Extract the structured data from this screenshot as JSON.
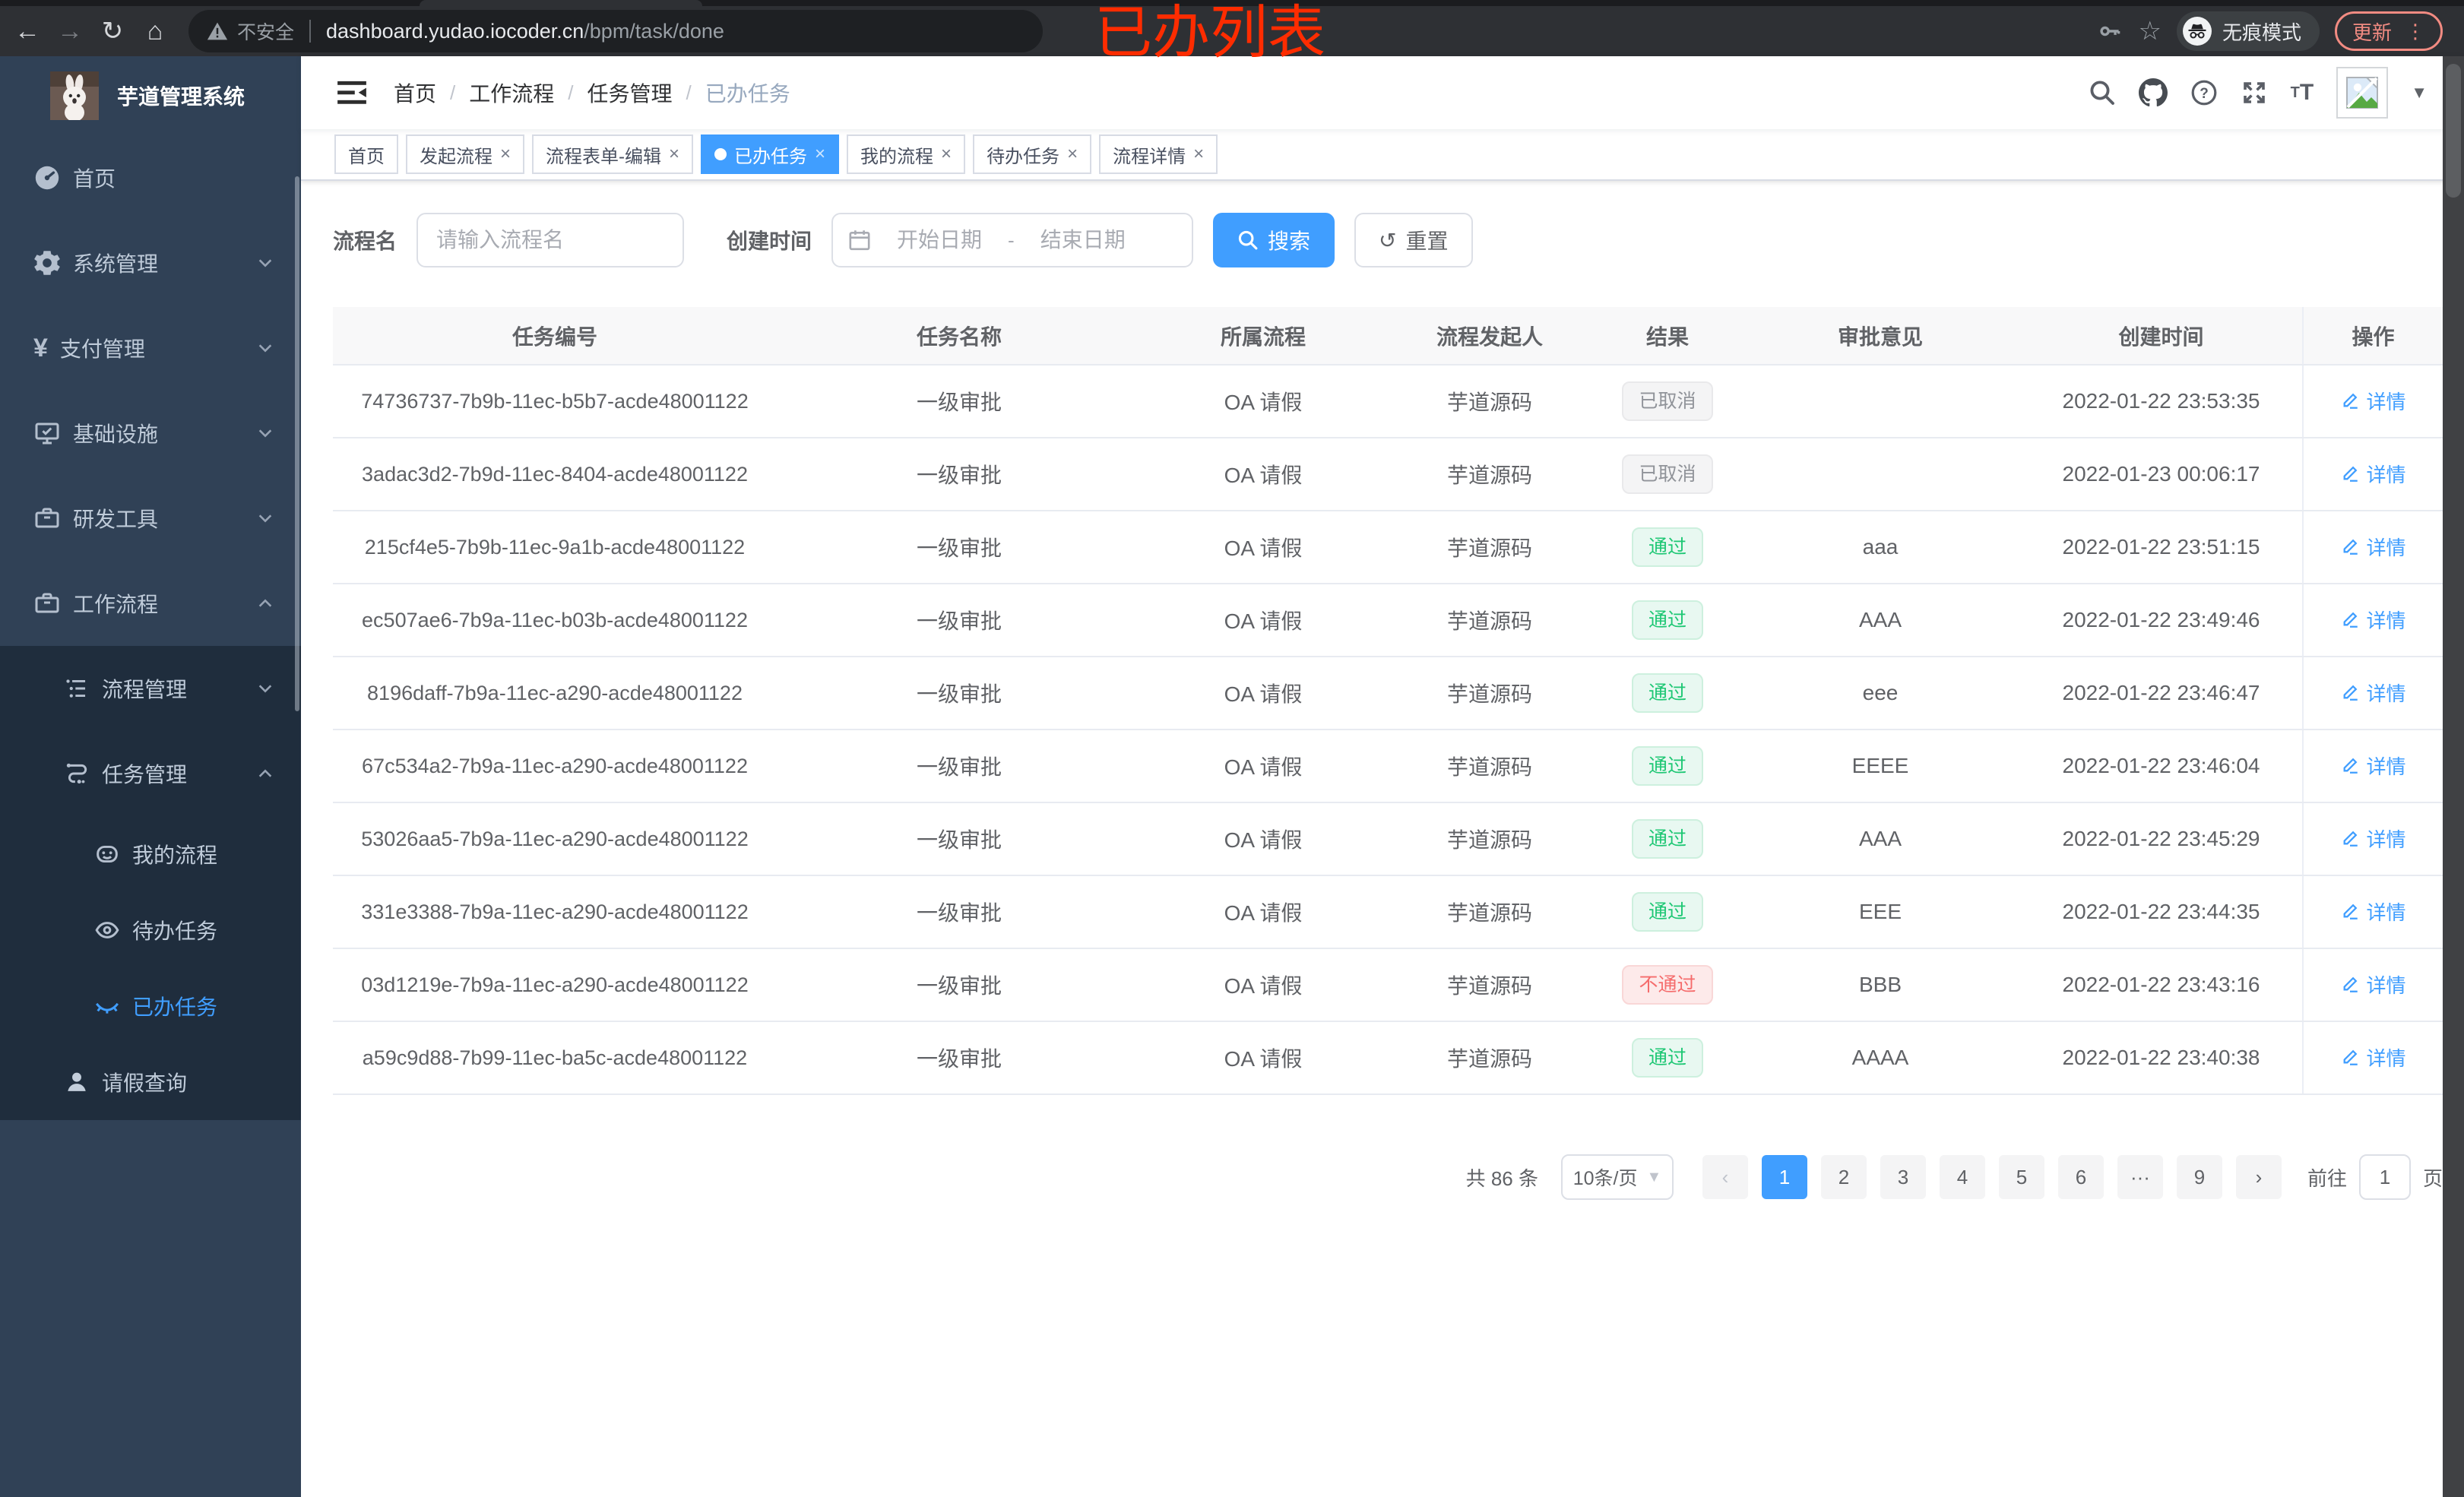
{
  "browser": {
    "security_label": "不安全",
    "url_domain": "dashboard.yudao.iocoder.cn",
    "url_path": "/bpm/task/done",
    "incognito_label": "无痕模式",
    "update_label": "更新"
  },
  "annotation": {
    "text": "已办列表",
    "color": "#fe2c00"
  },
  "sidebar": {
    "title": "芋道管理系统",
    "items": [
      {
        "label": "首页"
      },
      {
        "label": "系统管理"
      },
      {
        "label": "支付管理"
      },
      {
        "label": "基础设施"
      },
      {
        "label": "研发工具"
      },
      {
        "label": "工作流程"
      }
    ],
    "submenu": [
      {
        "label": "流程管理"
      },
      {
        "label": "任务管理"
      },
      {
        "label": "我的流程"
      },
      {
        "label": "待办任务"
      },
      {
        "label": "已办任务"
      },
      {
        "label": "请假查询"
      }
    ]
  },
  "header": {
    "breadcrumb": [
      "首页",
      "工作流程",
      "任务管理",
      "已办任务"
    ]
  },
  "tabs": [
    {
      "label": "首页"
    },
    {
      "label": "发起流程"
    },
    {
      "label": "流程表单-编辑"
    },
    {
      "label": "已办任务"
    },
    {
      "label": "我的流程"
    },
    {
      "label": "待办任务"
    },
    {
      "label": "流程详情"
    }
  ],
  "filters": {
    "name_label": "流程名",
    "name_placeholder": "请输入流程名",
    "date_label": "创建时间",
    "date_start_placeholder": "开始日期",
    "date_separator": "-",
    "date_end_placeholder": "结束日期",
    "search_label": "搜索",
    "reset_label": "重置"
  },
  "table": {
    "columns": [
      "任务编号",
      "任务名称",
      "所属流程",
      "流程发起人",
      "结果",
      "审批意见",
      "创建时间",
      "操作"
    ],
    "action_label": "详情",
    "rows": [
      {
        "id": "74736737-7b9b-11ec-b5b7-acde48001122",
        "name": "一级审批",
        "process": "OA 请假",
        "initiator": "芋道源码",
        "result": {
          "text": "已取消",
          "type": "info"
        },
        "comment": "",
        "time": "2022-01-22 23:53:35"
      },
      {
        "id": "3adac3d2-7b9d-11ec-8404-acde48001122",
        "name": "一级审批",
        "process": "OA 请假",
        "initiator": "芋道源码",
        "result": {
          "text": "已取消",
          "type": "info"
        },
        "comment": "",
        "time": "2022-01-23 00:06:17"
      },
      {
        "id": "215cf4e5-7b9b-11ec-9a1b-acde48001122",
        "name": "一级审批",
        "process": "OA 请假",
        "initiator": "芋道源码",
        "result": {
          "text": "通过",
          "type": "success"
        },
        "comment": "aaa",
        "time": "2022-01-22 23:51:15"
      },
      {
        "id": "ec507ae6-7b9a-11ec-b03b-acde48001122",
        "name": "一级审批",
        "process": "OA 请假",
        "initiator": "芋道源码",
        "result": {
          "text": "通过",
          "type": "success"
        },
        "comment": "AAA",
        "time": "2022-01-22 23:49:46"
      },
      {
        "id": "8196daff-7b9a-11ec-a290-acde48001122",
        "name": "一级审批",
        "process": "OA 请假",
        "initiator": "芋道源码",
        "result": {
          "text": "通过",
          "type": "success"
        },
        "comment": "eee",
        "time": "2022-01-22 23:46:47"
      },
      {
        "id": "67c534a2-7b9a-11ec-a290-acde48001122",
        "name": "一级审批",
        "process": "OA 请假",
        "initiator": "芋道源码",
        "result": {
          "text": "通过",
          "type": "success"
        },
        "comment": "EEEE",
        "time": "2022-01-22 23:46:04"
      },
      {
        "id": "53026aa5-7b9a-11ec-a290-acde48001122",
        "name": "一级审批",
        "process": "OA 请假",
        "initiator": "芋道源码",
        "result": {
          "text": "通过",
          "type": "success"
        },
        "comment": "AAA",
        "time": "2022-01-22 23:45:29"
      },
      {
        "id": "331e3388-7b9a-11ec-a290-acde48001122",
        "name": "一级审批",
        "process": "OA 请假",
        "initiator": "芋道源码",
        "result": {
          "text": "通过",
          "type": "success"
        },
        "comment": "EEE",
        "time": "2022-01-22 23:44:35"
      },
      {
        "id": "03d1219e-7b9a-11ec-a290-acde48001122",
        "name": "一级审批",
        "process": "OA 请假",
        "initiator": "芋道源码",
        "result": {
          "text": "不通过",
          "type": "danger"
        },
        "comment": "BBB",
        "time": "2022-01-22 23:43:16"
      },
      {
        "id": "a59c9d88-7b99-11ec-ba5c-acde48001122",
        "name": "一级审批",
        "process": "OA 请假",
        "initiator": "芋道源码",
        "result": {
          "text": "通过",
          "type": "success"
        },
        "comment": "AAAA",
        "time": "2022-01-22 23:40:38"
      }
    ]
  },
  "pagination": {
    "total": "共 86 条",
    "page_size": "10条/页",
    "pages": [
      "1",
      "2",
      "3",
      "4",
      "5",
      "6",
      "···",
      "9"
    ],
    "active_page": "1",
    "goto_label": "前往",
    "goto_value": "1",
    "goto_unit": "页"
  }
}
